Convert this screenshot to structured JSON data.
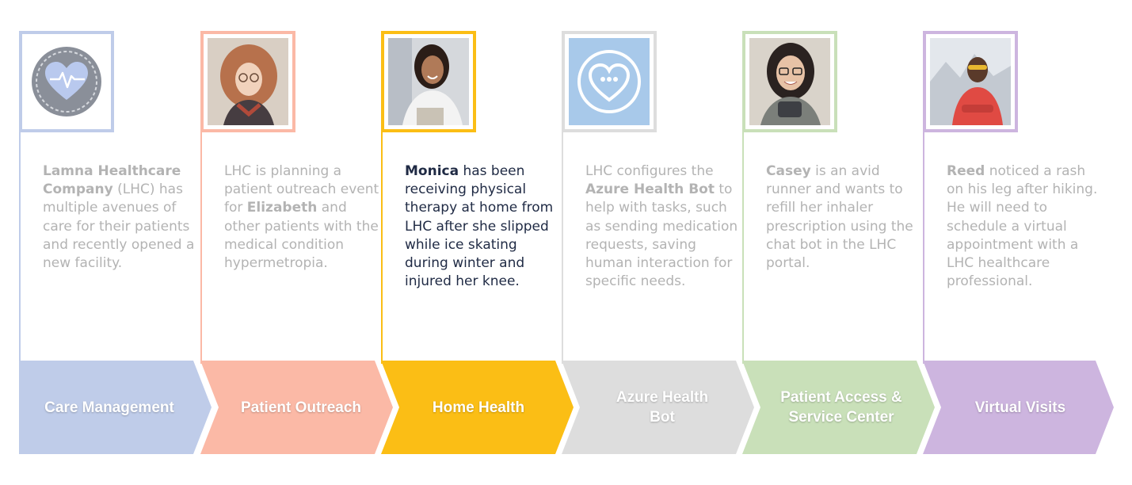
{
  "columns": [
    {
      "id": "care-management",
      "color": "#bfcce9",
      "stage": "Care Management",
      "photo": "heart-rate-icon",
      "desc_lead": "Lamna Healthcare Company",
      "desc_rest": " (LHC) has multiple avenues of care for their patients and recently opened a new facility."
    },
    {
      "id": "patient-outreach",
      "color": "#fbb9a6",
      "stage": "Patient Outreach",
      "photo": "elizabeth-portrait",
      "desc_pre": "LHC is planning a patient outreach event for ",
      "desc_bold": "Elizabeth",
      "desc_post": " and other patients with the medical condition hypermetropia."
    },
    {
      "id": "home-health",
      "color": "#fbbe15",
      "stage": "Home Health",
      "photo": "monica-portrait",
      "desc_lead": "Monica",
      "desc_rest": " has been receiving physical therapy at home from LHC after she slipped while ice skating during winter and injured her knee."
    },
    {
      "id": "azure-health-bot",
      "color": "#dddddd",
      "stage": "Azure Health Bot",
      "photo": "chat-heart-icon",
      "desc_pre": "LHC configures the ",
      "desc_bold": "Azure Health Bot",
      "desc_post": " to help with tasks, such as sending medication requests, saving human interaction for specific needs."
    },
    {
      "id": "patient-access",
      "color": "#c9e0b9",
      "stage": "Patient Access & Service Center",
      "photo": "casey-portrait",
      "desc_lead": "Casey",
      "desc_rest": " is an avid runner and wants to refill her inhaler prescription using the chat bot in the LHC portal."
    },
    {
      "id": "virtual-visits",
      "color": "#cdb5df",
      "stage": "Virtual Visits",
      "photo": "reed-portrait",
      "desc_lead": "Reed",
      "desc_rest": " noticed a rash on his leg after hiking. He will need to schedule a virtual appointment with a LHC healthcare professional."
    }
  ]
}
